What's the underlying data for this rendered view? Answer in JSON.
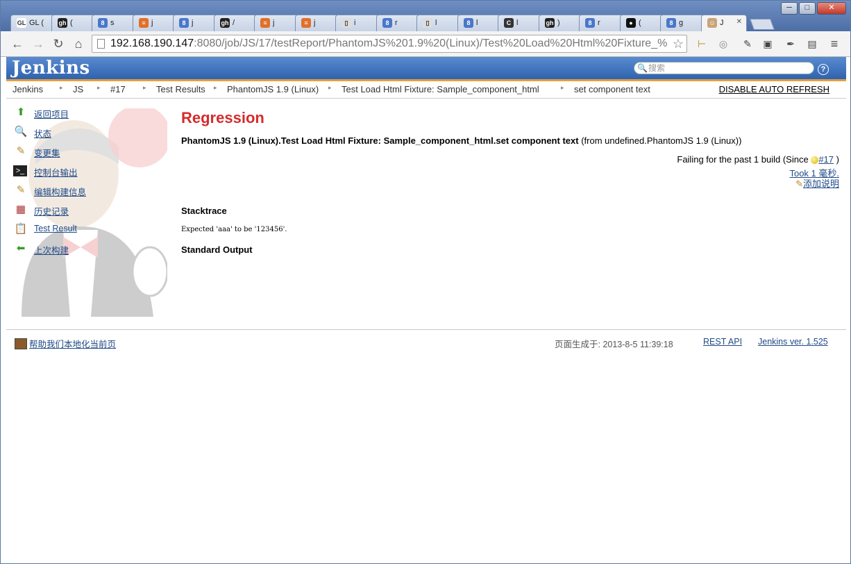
{
  "browser": {
    "tabs": [
      {
        "label": "GL (",
        "color": "#ffffff",
        "glyph": "GL"
      },
      {
        "label": "(",
        "color": "#222222",
        "glyph": "gh"
      },
      {
        "label": "s",
        "color": "#4a77c9",
        "glyph": "8"
      },
      {
        "label": "j",
        "color": "#e0702a",
        "glyph": "≡"
      },
      {
        "label": "j",
        "color": "#4a77c9",
        "glyph": "8"
      },
      {
        "label": "/",
        "color": "#222222",
        "glyph": "gh"
      },
      {
        "label": "j",
        "color": "#e0702a",
        "glyph": "≡"
      },
      {
        "label": "j",
        "color": "#e0702a",
        "glyph": "≡"
      },
      {
        "label": "i",
        "color": "#dddddd",
        "glyph": "▯"
      },
      {
        "label": "r",
        "color": "#4a77c9",
        "glyph": "8"
      },
      {
        "label": "l",
        "color": "#dddddd",
        "glyph": "▯"
      },
      {
        "label": "l",
        "color": "#4a77c9",
        "glyph": "8"
      },
      {
        "label": "l",
        "color": "#333333",
        "glyph": "C"
      },
      {
        "label": ")",
        "color": "#222222",
        "glyph": "gh"
      },
      {
        "label": "r",
        "color": "#4a77c9",
        "glyph": "8"
      },
      {
        "label": "(",
        "color": "#111111",
        "glyph": "●"
      },
      {
        "label": "g",
        "color": "#4a77c9",
        "glyph": "8"
      },
      {
        "label": "J",
        "color": "#c9a37a",
        "glyph": "☺"
      }
    ],
    "window_buttons": {
      "minimize": "─",
      "maximize": "□",
      "close": "✕"
    },
    "url_host": "192.168.190.147",
    "url_rest": ":8080/job/JS/17/testReport/PhantomJS%201.9%20(Linux)/Test%20Load%20Html%20Fixture_%"
  },
  "jenkins": {
    "logo": "Jenkins",
    "search_placeholder": "搜索",
    "help": "?"
  },
  "breadcrumbs": [
    "Jenkins",
    "JS",
    "#17",
    "Test Results",
    "PhantomJS 1.9 (Linux)",
    "Test Load Html Fixture: Sample_component_html",
    "set component text"
  ],
  "disable_auto_refresh": "DISABLE AUTO REFRESH",
  "sidebar": [
    {
      "label": "返回项目",
      "icon": "up-arrow-icon"
    },
    {
      "label": "状态",
      "icon": "magnifier-icon"
    },
    {
      "label": "变更集",
      "icon": "notepad-icon"
    },
    {
      "label": "控制台输出",
      "icon": "terminal-icon"
    },
    {
      "label": "编辑构建信息",
      "icon": "notepad-icon"
    },
    {
      "label": "历史记录",
      "icon": "history-icon"
    },
    {
      "label": "Test Result",
      "icon": "clipboard-icon"
    },
    {
      "label": "上次构建",
      "icon": "left-arrow-icon"
    }
  ],
  "main": {
    "status_title": "Regression",
    "test_name": "PhantomJS 1.9 (Linux).Test Load Html Fixture: Sample_component_html.set component text",
    "test_origin": "(from undefined.PhantomJS 1.9 (Linux))",
    "failing_prefix": "Failing for the past 1 build (Since",
    "failing_build": "#17",
    "failing_suffix": ")",
    "took": "Took 1 毫秒.",
    "add_description": "添加说明",
    "stacktrace_heading": "Stacktrace",
    "stacktrace": "Expected 'aaa' to be '123456'.",
    "stdout_heading": "Standard Output"
  },
  "footer": {
    "localize": "帮助我们本地化当前页",
    "generated": "页面生成于: 2013-8-5 11:39:18",
    "rest_api": "REST API",
    "version": "Jenkins ver. 1.525"
  }
}
